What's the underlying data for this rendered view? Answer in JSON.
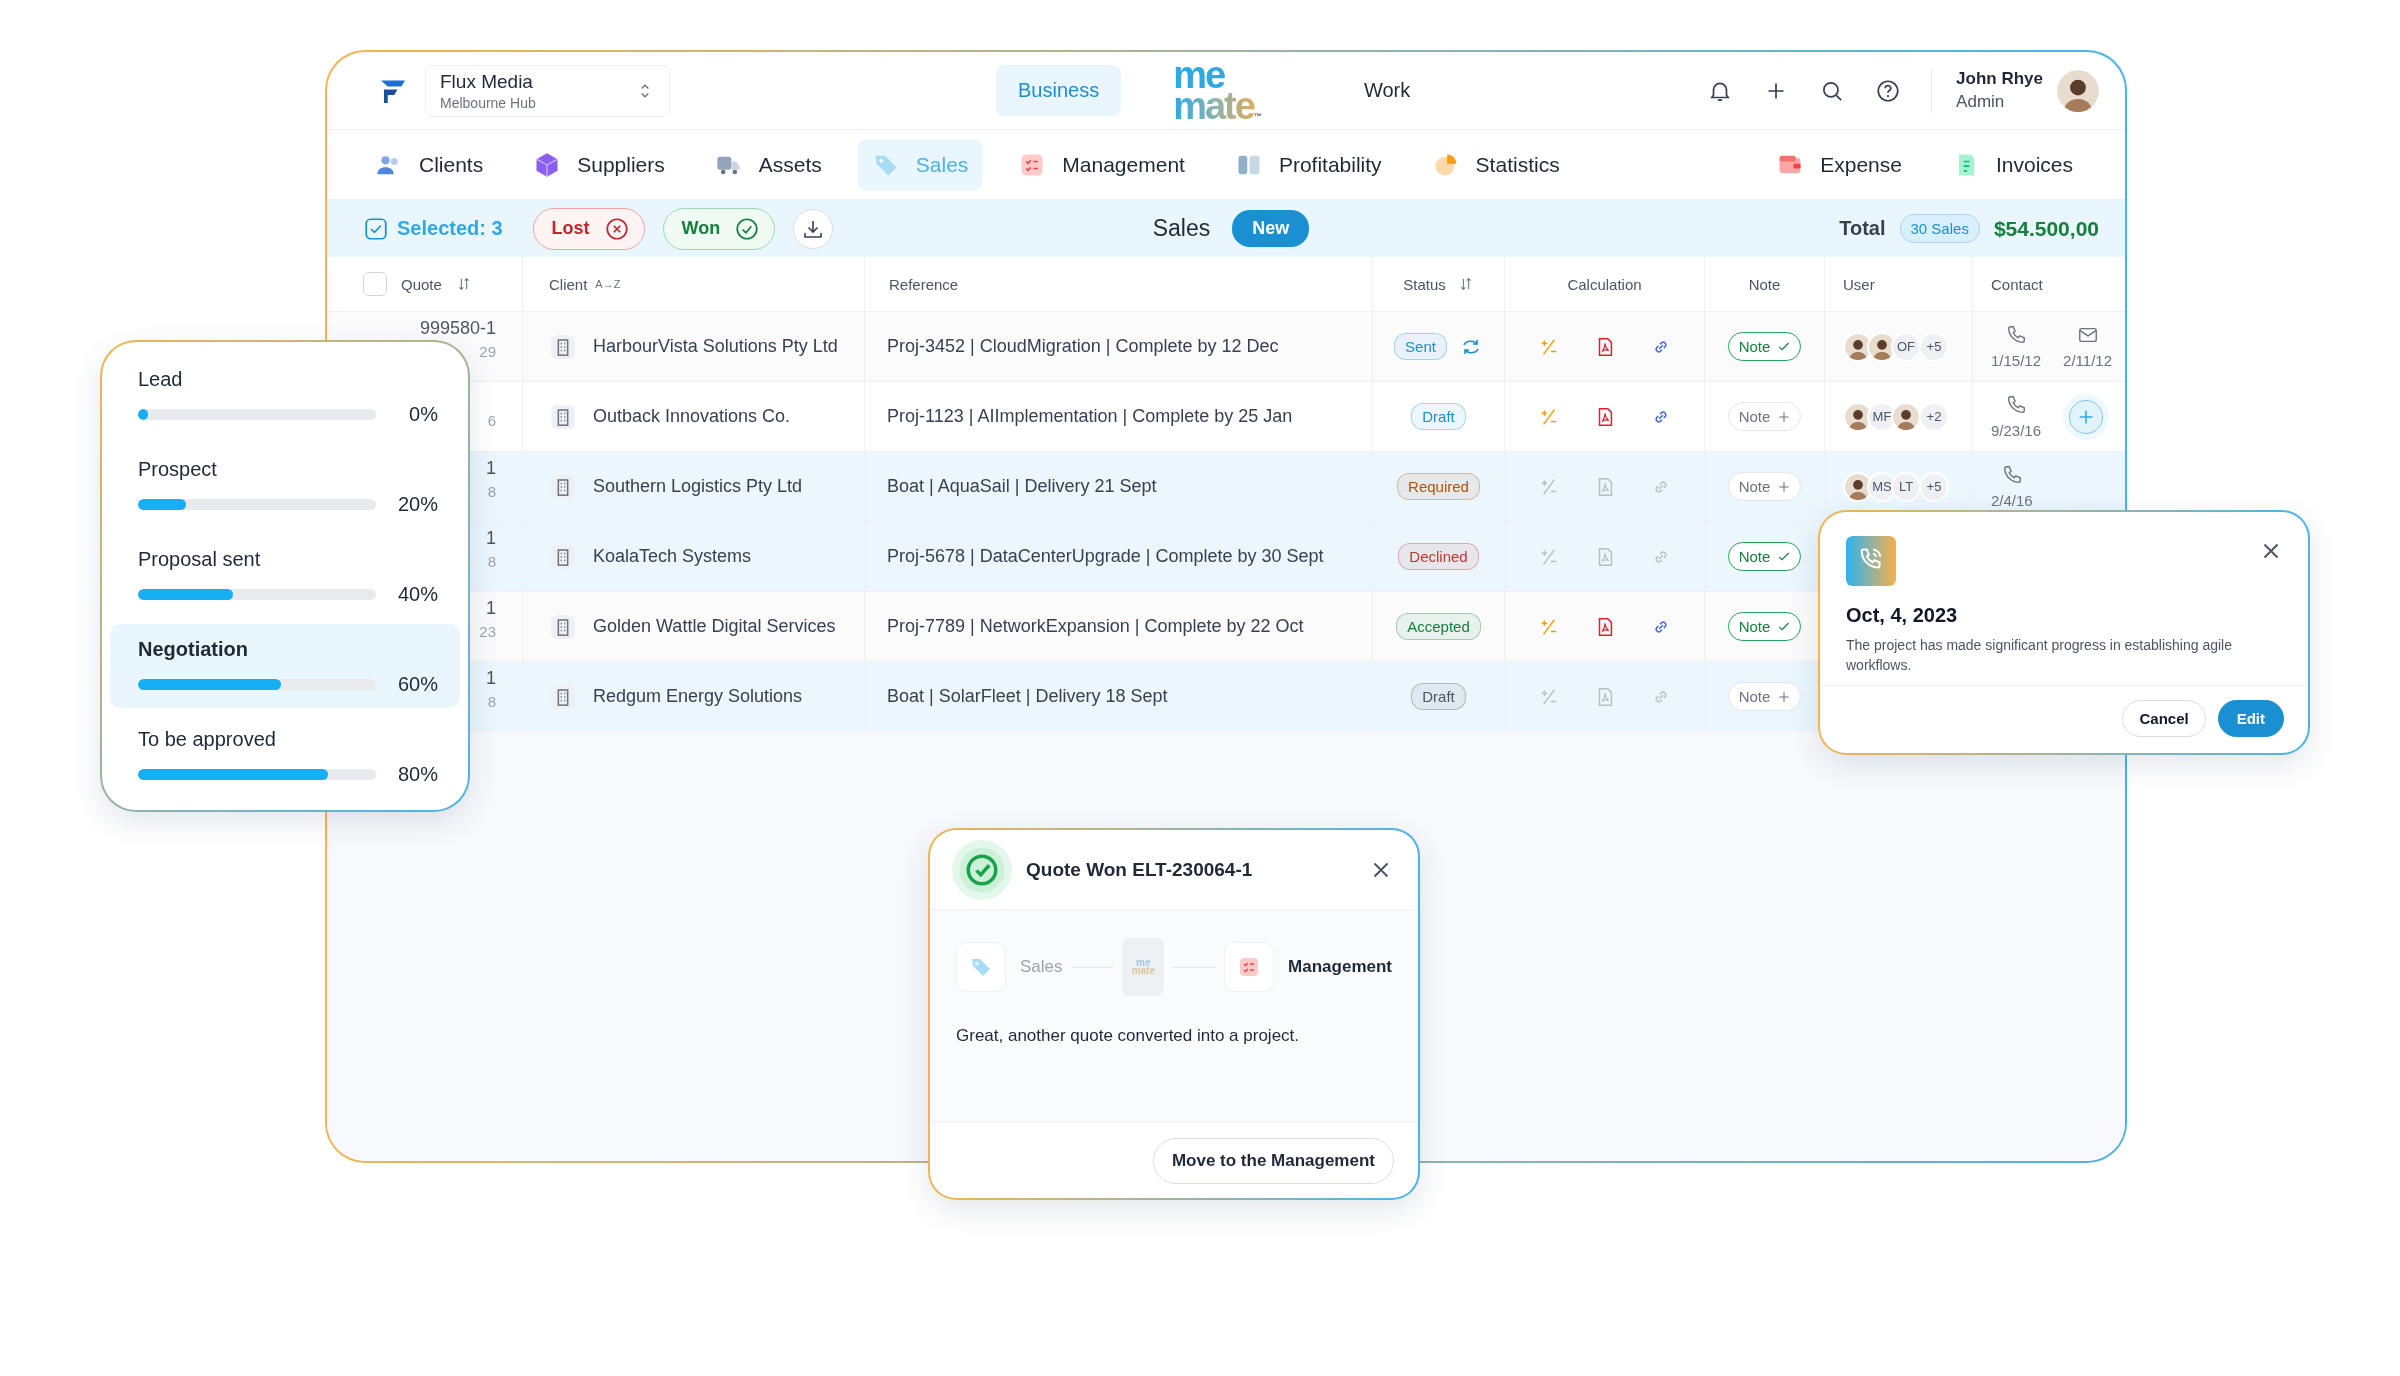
{
  "header": {
    "company": {
      "name": "Flux Media",
      "location": "Melbourne Hub"
    },
    "modes": [
      {
        "label": "Business",
        "selected": true
      },
      {
        "label": "Work",
        "selected": false
      }
    ],
    "logo": {
      "top": "me",
      "bottom": "mate",
      "mark": "™"
    },
    "user": {
      "name": "John Rhye",
      "role": "Admin"
    }
  },
  "nav": {
    "main": [
      {
        "label": "Clients",
        "selected": false
      },
      {
        "label": "Suppliers",
        "selected": false
      },
      {
        "label": "Assets",
        "selected": false
      },
      {
        "label": "Sales",
        "selected": true
      },
      {
        "label": "Management",
        "selected": false
      },
      {
        "label": "Profitability",
        "selected": false
      },
      {
        "label": "Statistics",
        "selected": false
      }
    ],
    "end": [
      {
        "label": "Expense",
        "selected": false
      },
      {
        "label": "Invoices",
        "selected": false
      }
    ]
  },
  "toolbar": {
    "selected_label": "Selected: 3",
    "filters": [
      {
        "label": "Lost",
        "kind": "lost"
      },
      {
        "label": "Won",
        "kind": "won"
      }
    ],
    "title": "Sales",
    "new_button": "New",
    "total_label": "Total",
    "count_badge": "30 Sales",
    "total": "$54.500,00"
  },
  "table": {
    "select_all": {
      "checked": false
    },
    "columns": [
      {
        "label": "Quote",
        "sortable": true
      },
      {
        "label": "Client",
        "sortable": false,
        "sort_text": "A→Z"
      },
      {
        "label": "Reference",
        "sortable": false
      },
      {
        "label": "Status",
        "sortable": true
      },
      {
        "label": "Calculation",
        "sortable": false
      },
      {
        "label": "Note",
        "sortable": false
      },
      {
        "label": "User",
        "sortable": false
      },
      {
        "label": "Contact",
        "sortable": false
      }
    ],
    "rows": [
      {
        "selected": false,
        "quote": {
          "number": "999580-1",
          "sub": "29"
        },
        "client": "HarbourVista Solutions Pty Ltd",
        "reference": "Proj-3452 | CloudMigration | Complete by 12 Dec",
        "status": {
          "label": "Sent",
          "color": "#1a8fd1"
        },
        "recurring": true,
        "calc_active": true,
        "note": "Note",
        "note_added": true,
        "users": [
          {
            "kind": "photo"
          },
          {
            "kind": "photo"
          },
          {
            "kind": "initials",
            "text": "OF"
          },
          {
            "kind": "more",
            "text": "+5"
          }
        ],
        "contacts": [
          {
            "kind": "phone",
            "date": "1/15/12"
          },
          {
            "kind": "mail",
            "date": "2/11/12"
          }
        ]
      },
      {
        "selected": false,
        "quote": {
          "sub": "6"
        },
        "client": "Outback Innovations Co.",
        "reference": "Proj-1123 | AIImplementation | Complete by 25 Jan",
        "status": {
          "label": "Draft",
          "color": "#1a8fd1"
        },
        "recurring": false,
        "calc_active": true,
        "note": "Note",
        "note_added": false,
        "users": [
          {
            "kind": "photo"
          },
          {
            "kind": "initials",
            "text": "MF"
          },
          {
            "kind": "photo"
          },
          {
            "kind": "more",
            "text": "+2"
          }
        ],
        "contacts": [
          {
            "kind": "phone",
            "date": "9/23/16"
          },
          {
            "kind": "add"
          }
        ]
      },
      {
        "selected": true,
        "quote": {
          "number": "1",
          "sub": "8"
        },
        "client": "Southern  Logistics Pty Ltd",
        "reference": "Boat | AquaSail | Delivery 21 Sept",
        "status": {
          "label": "Required",
          "color": "#b45309"
        },
        "recurring": false,
        "calc_active": false,
        "note": "Note",
        "note_added": false,
        "users": [
          {
            "kind": "photo"
          },
          {
            "kind": "initials",
            "text": "MS"
          },
          {
            "kind": "initials",
            "text": "LT"
          },
          {
            "kind": "more",
            "text": "+5"
          }
        ],
        "contacts": [
          {
            "kind": "phone",
            "date": "2/4/16"
          }
        ]
      },
      {
        "selected": true,
        "quote": {
          "number": "1",
          "sub": "8"
        },
        "client": "KoalaTech Systems",
        "reference": "Proj-5678 | DataCenterUpgrade | Complete by 30 Sept",
        "status": {
          "label": "Declined",
          "color": "#c0392b"
        },
        "recurring": false,
        "calc_active": false,
        "note": "Note",
        "note_added": true
      },
      {
        "selected": false,
        "quote": {
          "number": "1",
          "sub": "23"
        },
        "client": "Golden Wattle Digital Services",
        "reference": "Proj-7789 | NetworkExpansion | Complete by 22 Oct",
        "status": {
          "label": "Accepted",
          "color": "#15803d"
        },
        "recurring": false,
        "calc_active": true,
        "note": "Note",
        "note_added": true
      },
      {
        "selected": true,
        "quote": {
          "number": "1",
          "sub": "8"
        },
        "client": "Redgum Energy Solutions",
        "reference": "Boat | SolarFleet | Delivery 18 Sept",
        "status": {
          "label": "Draft",
          "color": "#4b5563"
        },
        "recurring": false,
        "calc_active": false,
        "note": "Note",
        "note_added": false
      }
    ]
  },
  "stages_panel": {
    "stages": [
      {
        "label": "Lead",
        "level": 0,
        "percent": "0%",
        "selected": false
      },
      {
        "label": "Prospect",
        "level": 0.2,
        "percent": "20%",
        "selected": false
      },
      {
        "label": "Proposal sent",
        "level": 0.4,
        "percent": "40%",
        "selected": false
      },
      {
        "label": "Negotiation",
        "level": 0.6,
        "percent": "60%",
        "selected": true
      },
      {
        "label": "To be approved",
        "level": 0.8,
        "percent": "80%",
        "selected": false
      }
    ]
  },
  "note_popup": {
    "date": "Oct, 4, 2023",
    "text": "The project has made significant progress in establishing agile workflows.",
    "buttons": [
      {
        "label": "Cancel",
        "kind": "secondary"
      },
      {
        "label": "Edit",
        "kind": "primary"
      }
    ]
  },
  "won_modal": {
    "title": "Quote Won ELT-230064-1",
    "flow": [
      {
        "kind": "step",
        "label": "Sales",
        "active": false
      },
      {
        "kind": "logo",
        "top": "me",
        "bottom": "mate"
      },
      {
        "kind": "step",
        "label": "Management",
        "active": true
      }
    ],
    "message": "Great, another quote converted into a project.",
    "action": "Move to the Management"
  }
}
